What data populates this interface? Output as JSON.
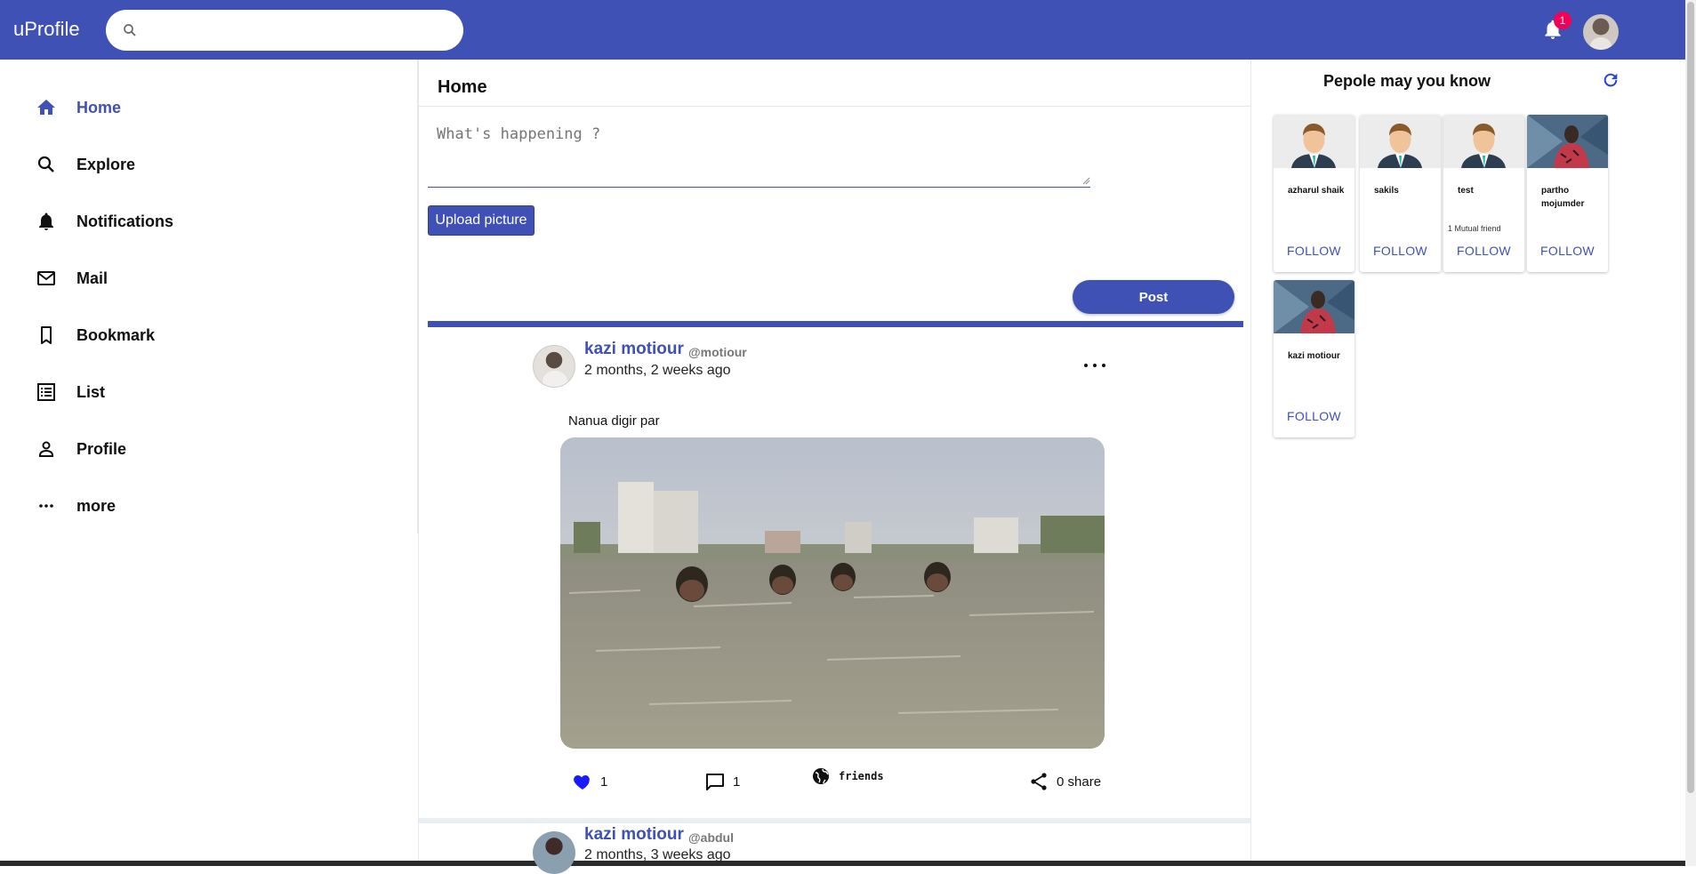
{
  "app": {
    "brand": "uProfile"
  },
  "search": {
    "value": "",
    "placeholder": ""
  },
  "header": {
    "notification_count": "1"
  },
  "sidebar": {
    "items": [
      {
        "label": "Home",
        "icon": "home-icon",
        "active": true
      },
      {
        "label": "Explore",
        "icon": "search-icon"
      },
      {
        "label": "Notifications",
        "icon": "bell-icon"
      },
      {
        "label": "Mail",
        "icon": "mail-icon"
      },
      {
        "label": "Bookmark",
        "icon": "bookmark-icon"
      },
      {
        "label": "List",
        "icon": "list-icon"
      },
      {
        "label": "Profile",
        "icon": "person-icon"
      },
      {
        "label": "more",
        "icon": "more-horizontal-icon"
      }
    ]
  },
  "feed": {
    "title": "Home",
    "composer_placeholder": "What's happening ?",
    "upload_label": "Upload picture",
    "post_label": "Post"
  },
  "posts": [
    {
      "author": "kazi motiour",
      "handle": "@motiour",
      "time": "2 months, 2 weeks ago",
      "text": "Nanua digir par",
      "likes": "1",
      "comments": "1",
      "privacy": "friends",
      "shares": "0 share"
    },
    {
      "author": "kazi motiour",
      "handle": "@abdul",
      "time": "2 months, 3 weeks ago"
    }
  ],
  "suggestions": {
    "title": "Pepole may you know",
    "follow_label": "FOLLOW",
    "people": [
      {
        "name": "azharul shaik",
        "mutual": ""
      },
      {
        "name": "sakils",
        "mutual": ""
      },
      {
        "name": "test",
        "mutual": "1 Mutual friend"
      },
      {
        "name": "partho mojumder",
        "mutual": ""
      },
      {
        "name": "kazi motiour",
        "mutual": ""
      }
    ]
  },
  "colors": {
    "primary": "#3f51b5",
    "badge": "#f50057",
    "like": "#1a1aff"
  }
}
